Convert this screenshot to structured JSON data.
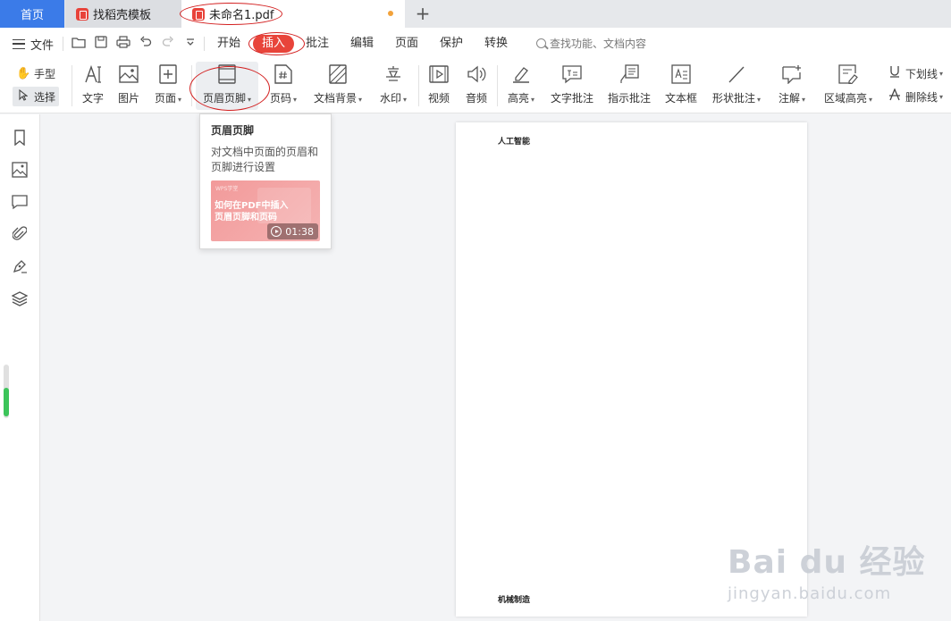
{
  "tabs": {
    "home": "首页",
    "template": "找稻壳模板",
    "document": "未命名1.pdf",
    "new_tab": "+"
  },
  "menu": {
    "file": "文件",
    "tabs": [
      "开始",
      "插入",
      "批注",
      "编辑",
      "页面",
      "保护",
      "转换"
    ],
    "active_tab": "插入",
    "search_placeholder": "查找功能、文档内容"
  },
  "ribbon": {
    "modes": [
      "手型",
      "选择"
    ],
    "tools": [
      {
        "label": "文字",
        "icon": "text-icon",
        "has_caret": false
      },
      {
        "label": "图片",
        "icon": "image-icon",
        "has_caret": false
      },
      {
        "label": "页面",
        "icon": "add-page-icon",
        "has_caret": true
      },
      {
        "label": "页眉页脚",
        "icon": "header-footer-icon",
        "has_caret": true
      },
      {
        "label": "页码",
        "icon": "page-number-icon",
        "has_caret": true
      },
      {
        "label": "文档背景",
        "icon": "background-icon",
        "has_caret": true
      },
      {
        "label": "水印",
        "icon": "watermark-icon",
        "has_caret": true
      },
      {
        "label": "视频",
        "icon": "video-icon",
        "has_caret": false
      },
      {
        "label": "音频",
        "icon": "audio-icon",
        "has_caret": false
      },
      {
        "label": "高亮",
        "icon": "highlight-icon",
        "has_caret": true
      },
      {
        "label": "文字批注",
        "icon": "text-comment-icon",
        "has_caret": false
      },
      {
        "label": "指示批注",
        "icon": "pointer-comment-icon",
        "has_caret": false
      },
      {
        "label": "文本框",
        "icon": "textbox-icon",
        "has_caret": false
      },
      {
        "label": "形状批注",
        "icon": "shape-comment-icon",
        "has_caret": true
      },
      {
        "label": "注解",
        "icon": "annotation-icon",
        "has_caret": true
      },
      {
        "label": "区域高亮",
        "icon": "area-highlight-icon",
        "has_caret": true
      }
    ],
    "underline": "下划线",
    "strikethrough": "删除线"
  },
  "popup": {
    "title": "页眉页脚",
    "description": "对文档中页面的页眉和页脚进行设置",
    "thumb_brand": "WPS学堂",
    "thumb_text_1": "如何在PDF中插入",
    "thumb_text_2": "页眉页脚和页码",
    "duration": "01:38"
  },
  "document": {
    "header": "人工智能",
    "footer": "机械制造"
  },
  "watermark": {
    "main": "Bai du 经验",
    "sub": "jingyan.baidu.com"
  },
  "colors": {
    "accent": "#3b7be8",
    "active_tab": "#e8443a",
    "annotation": "#d32020",
    "scroll": "#3cc45a"
  }
}
